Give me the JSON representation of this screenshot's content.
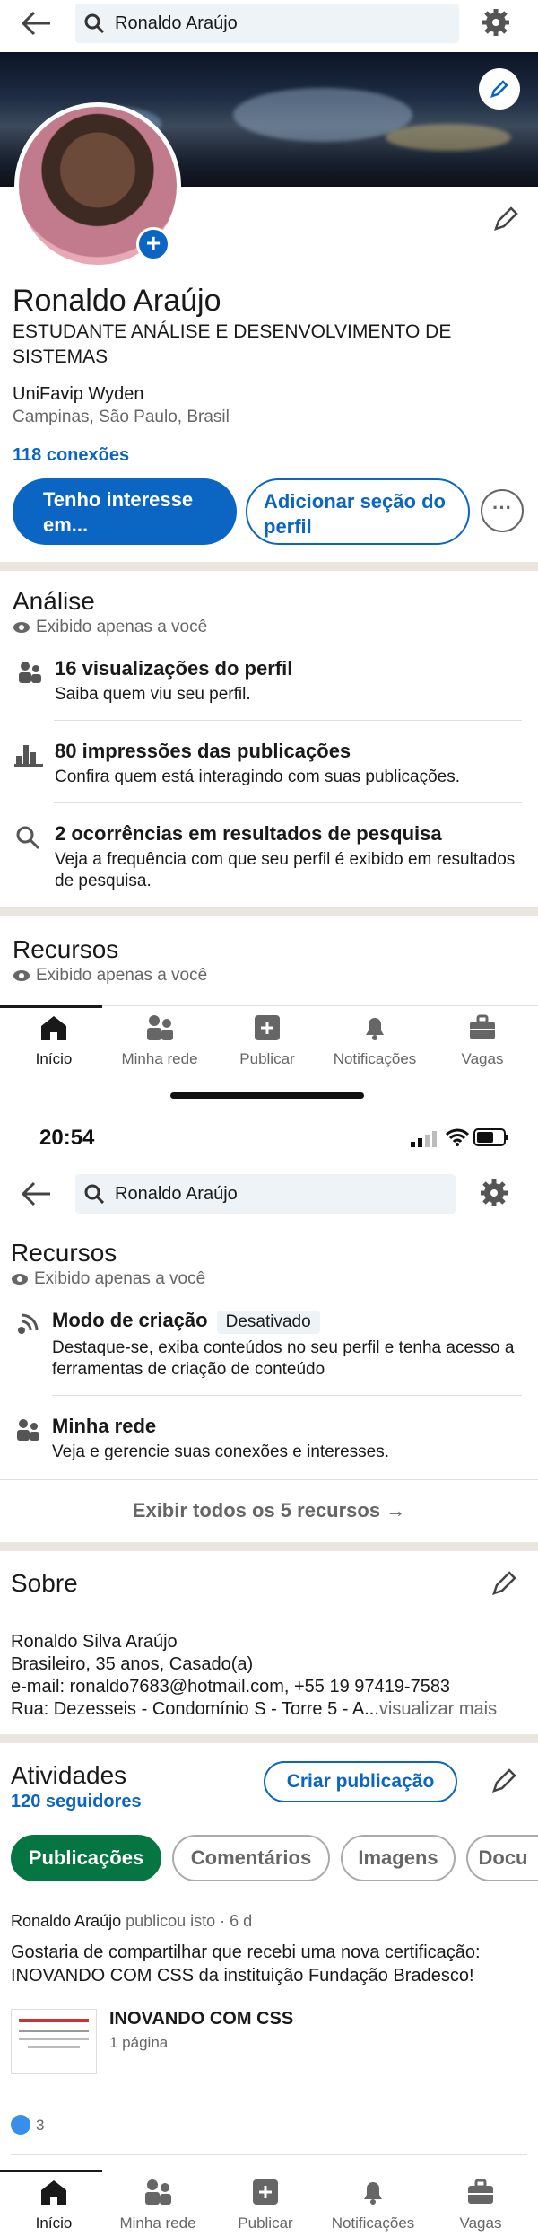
{
  "search": {
    "query": "Ronaldo Araújo"
  },
  "profile": {
    "name": "Ronaldo Araújo",
    "headline": "ESTUDANTE ANÁLISE E DESENVOLVIMENTO DE SISTEMAS",
    "education": "UniFavip Wyden",
    "location": "Campinas, São Paulo, Brasil",
    "connections": "118 conexões",
    "btn_interest": "Tenho interesse em...",
    "btn_add_section": "Adicionar seção do perfil"
  },
  "analytics": {
    "title": "Análise",
    "private_note": "Exibido apenas a você",
    "items": [
      {
        "title": "16 visualizações do perfil",
        "sub": "Saiba quem viu seu perfil."
      },
      {
        "title": "80 impressões das publicações",
        "sub": "Confira quem está interagindo com suas publicações."
      },
      {
        "title": "2 ocorrências em resultados de pesquisa",
        "sub": "Veja a frequência com que seu perfil é exibido em resultados de pesquisa."
      }
    ]
  },
  "resources": {
    "title": "Recursos",
    "private_note": "Exibido apenas a você",
    "items": [
      {
        "title": "Modo de criação",
        "tag": "Desativado",
        "sub": "Destaque-se, exiba conteúdos no seu perfil e tenha acesso a ferramentas de criação de conteúdo"
      },
      {
        "title": "Minha rede",
        "sub": "Veja e gerencie suas conexões e interesses."
      }
    ],
    "show_all": "Exibir todos os 5 recursos →"
  },
  "nav": {
    "items": [
      {
        "label": "Início",
        "icon": "home-icon"
      },
      {
        "label": "Minha rede",
        "icon": "people-icon"
      },
      {
        "label": "Publicar",
        "icon": "plus-square-icon"
      },
      {
        "label": "Notificações",
        "icon": "bell-icon"
      },
      {
        "label": "Vagas",
        "icon": "briefcase-icon"
      }
    ]
  },
  "status_bar": {
    "time": "20:54"
  },
  "about": {
    "title": "Sobre",
    "lines": [
      "Ronaldo Silva Araújo",
      "Brasileiro, 35 anos, Casado(a)",
      "e-mail: ronaldo7683@hotmail.com, +55 19 97419-7583",
      "Rua: Dezesseis - Condomínio S - Torre 5 - A..."
    ],
    "see_more": "visualizar mais"
  },
  "activity": {
    "title": "Atividades",
    "followers": "120 seguidores",
    "create_post": "Criar publicação",
    "tabs": [
      "Publicações",
      "Comentários",
      "Imagens",
      "Docu"
    ],
    "post": {
      "author": "Ronaldo Araújo",
      "meta": " publicou isto · 6 d",
      "text": "Gostaria de compartilhar que recebi uma nova certificação: INOVANDO COM CSS da instituição Fundação Bradesco!",
      "doc_title": "INOVANDO COM CSS",
      "doc_pages": "1 página",
      "likes": "3"
    }
  },
  "colors": {
    "accent": "#0a66c2",
    "green": "#057642",
    "divider": "#e9e5df"
  }
}
